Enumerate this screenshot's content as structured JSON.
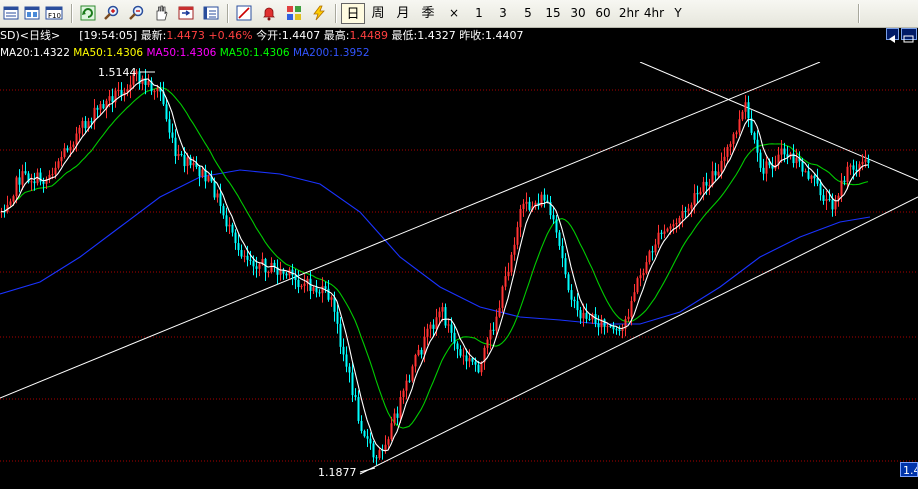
{
  "toolbar": {
    "periods": [
      "日",
      "周",
      "月",
      "季",
      "×",
      "1",
      "3",
      "5",
      "15",
      "30",
      "60",
      "2hr",
      "4hr",
      "Y"
    ],
    "active_period": "日"
  },
  "quote": {
    "symbol": "SD)<日线>",
    "time": "[19:54:05]",
    "latest_label": "最新:",
    "latest": "1.4473",
    "change": "+0.46%",
    "open_label": "今开:",
    "open": "1.4407",
    "high_label": "最高:",
    "high": "1.4489",
    "low_label": "最低:",
    "low": "1.4327",
    "prev_label": "昨收:",
    "prev": "1.4407"
  },
  "ma": [
    {
      "label": "MA20:1.4322",
      "color": "#ffffff"
    },
    {
      "label": "MA50:1.4306",
      "color": "#ffff00"
    },
    {
      "label": "MA50:1.4306",
      "color": "#ff00ff"
    },
    {
      "label": "MA50:1.4306",
      "color": "#00ff00"
    },
    {
      "label": "MA200:1.3952",
      "color": "#3355ff"
    }
  ],
  "chart_data": {
    "type": "candlestick",
    "title": "",
    "price_max_label": "1.5144",
    "price_min_label": "1.1877",
    "current_price_tag": "1.4",
    "colors": {
      "up": "#ff3333",
      "down": "#00ffff",
      "ma_short": "#ffffff",
      "ma_mid": "#00cc00",
      "ma_long": "#1a33ff",
      "trendline": "#ffffff",
      "grid": "#aa0000"
    }
  }
}
